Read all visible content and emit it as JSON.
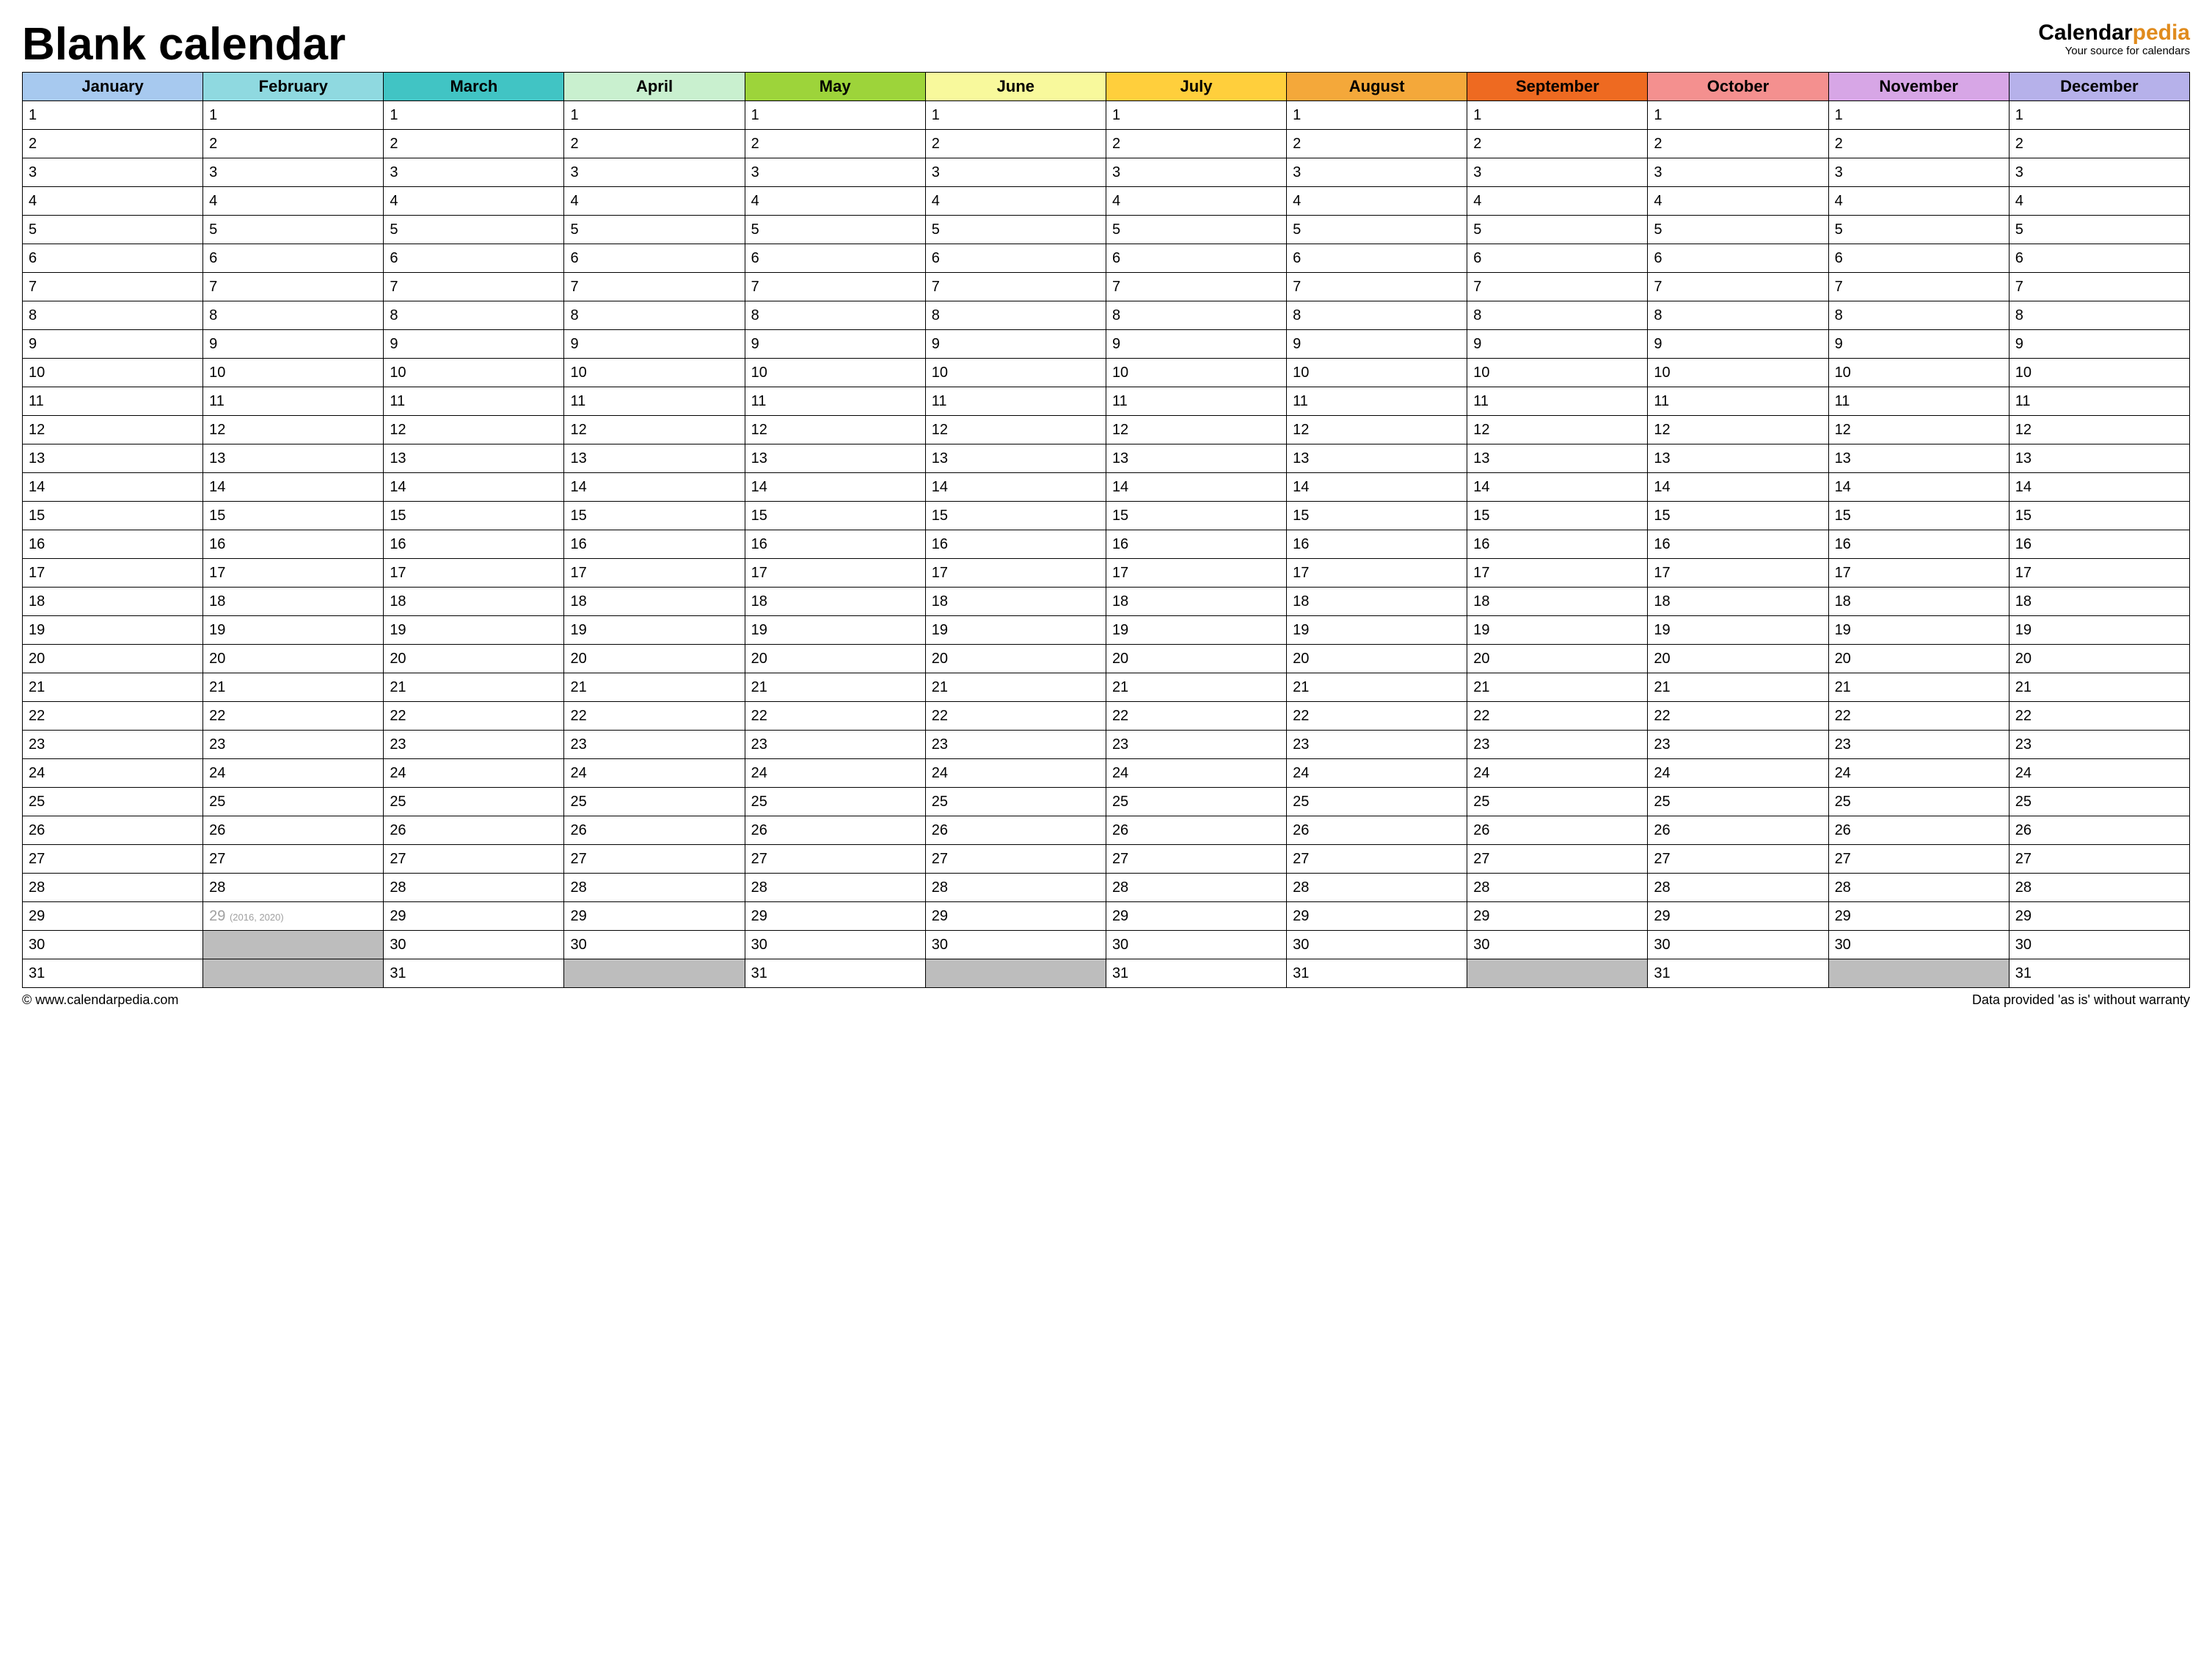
{
  "title": "Blank calendar",
  "brand": {
    "part1": "Calendar",
    "part2": "pedia",
    "tagline": "Your source for calendars"
  },
  "months": [
    {
      "name": "January",
      "color": "#a7c9ef",
      "days": 31
    },
    {
      "name": "February",
      "color": "#8fd9e0",
      "days": 29,
      "day29_light": true,
      "day29_note": "(2016, 2020)"
    },
    {
      "name": "March",
      "color": "#41c4c4",
      "days": 31
    },
    {
      "name": "April",
      "color": "#c9f0cf",
      "days": 30
    },
    {
      "name": "May",
      "color": "#9dd43a",
      "days": 31
    },
    {
      "name": "June",
      "color": "#f8f99c",
      "days": 30
    },
    {
      "name": "July",
      "color": "#ffcf3c",
      "days": 31
    },
    {
      "name": "August",
      "color": "#f4a83a",
      "days": 31
    },
    {
      "name": "September",
      "color": "#ee6a21",
      "days": 30
    },
    {
      "name": "October",
      "color": "#f4908f",
      "days": 31
    },
    {
      "name": "November",
      "color": "#d7a6e6",
      "days": 30
    },
    {
      "name": "December",
      "color": "#b6b1ea",
      "days": 31
    }
  ],
  "max_rows": 31,
  "footer": {
    "left": "© www.calendarpedia.com",
    "right": "Data provided 'as is' without warranty"
  }
}
